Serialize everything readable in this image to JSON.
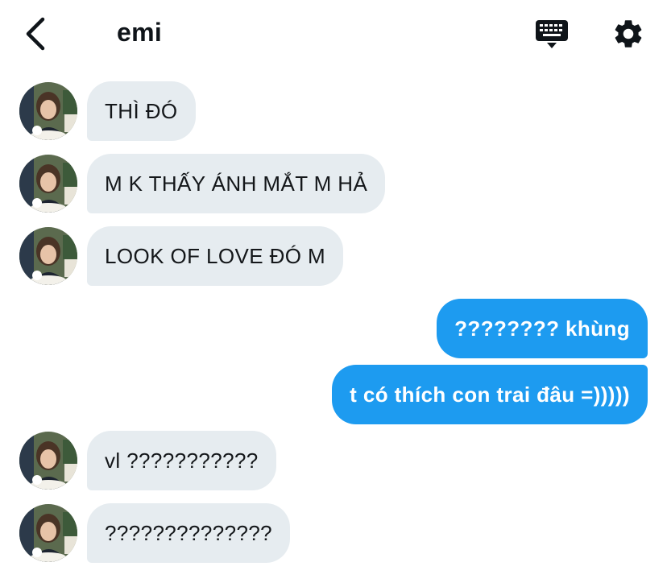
{
  "header": {
    "title": "emi",
    "back_icon": "chevron-left-icon",
    "keyboard_icon": "keyboard-icon",
    "settings_icon": "gear-icon"
  },
  "colors": {
    "incoming_bubble": "#e6ecf0",
    "outgoing_bubble": "#1d9bf0",
    "text": "#0f1419"
  },
  "messages": [
    {
      "direction": "in",
      "text": "THÌ ĐÓ"
    },
    {
      "direction": "in",
      "text": "M K THẤY ÁNH MẮT M HẢ"
    },
    {
      "direction": "in",
      "text": "LOOK OF LOVE ĐÓ M"
    },
    {
      "direction": "out",
      "text": "???????? khùng"
    },
    {
      "direction": "out",
      "text": "t có thích con trai đâu =)))))"
    },
    {
      "direction": "in",
      "text": "vl ???????????"
    },
    {
      "direction": "in",
      "text": "??????????????"
    }
  ]
}
